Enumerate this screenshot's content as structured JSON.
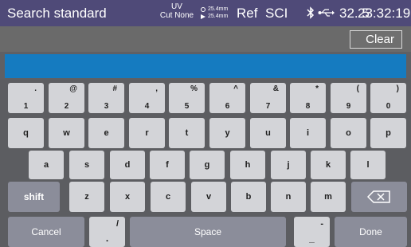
{
  "status": {
    "title": "Search standard",
    "uv_line1": "UV",
    "uv_line2": "Cut None",
    "meas1": "25.4mm",
    "meas2": "25.4mm",
    "ref": "Ref",
    "sci": "SCI",
    "temp": "32. 5",
    "time": "23:32:19"
  },
  "toolbar": {
    "clear_label": "Clear"
  },
  "search": {
    "value": "",
    "placeholder": ""
  },
  "keyboard": {
    "number_row": [
      {
        "primary": "1",
        "secondary": "."
      },
      {
        "primary": "2",
        "secondary": "@"
      },
      {
        "primary": "3",
        "secondary": "#"
      },
      {
        "primary": "4",
        "secondary": ","
      },
      {
        "primary": "5",
        "secondary": "%"
      },
      {
        "primary": "6",
        "secondary": "^"
      },
      {
        "primary": "7",
        "secondary": "&"
      },
      {
        "primary": "8",
        "secondary": "*"
      },
      {
        "primary": "9",
        "secondary": "("
      },
      {
        "primary": "0",
        "secondary": ")"
      }
    ],
    "row1": [
      "q",
      "w",
      "e",
      "r",
      "t",
      "y",
      "u",
      "i",
      "o",
      "p"
    ],
    "row2": [
      "a",
      "s",
      "d",
      "f",
      "g",
      "h",
      "j",
      "k",
      "l"
    ],
    "row3": [
      "z",
      "x",
      "c",
      "v",
      "b",
      "n",
      "m"
    ],
    "shift_label": "shift",
    "cancel_label": "Cancel",
    "space_label": "Space",
    "done_label": "Done",
    "slash_key": {
      "primary": ".",
      "secondary": "/"
    },
    "dash_key": {
      "primary": "_",
      "secondary": "-"
    },
    "icons": {
      "backspace": "backspace-icon"
    }
  },
  "colors": {
    "status_bar": "#4f4a78",
    "input_bar": "#157bc0",
    "key_light": "#d3d4d8",
    "key_dark": "#8b8d9a"
  }
}
